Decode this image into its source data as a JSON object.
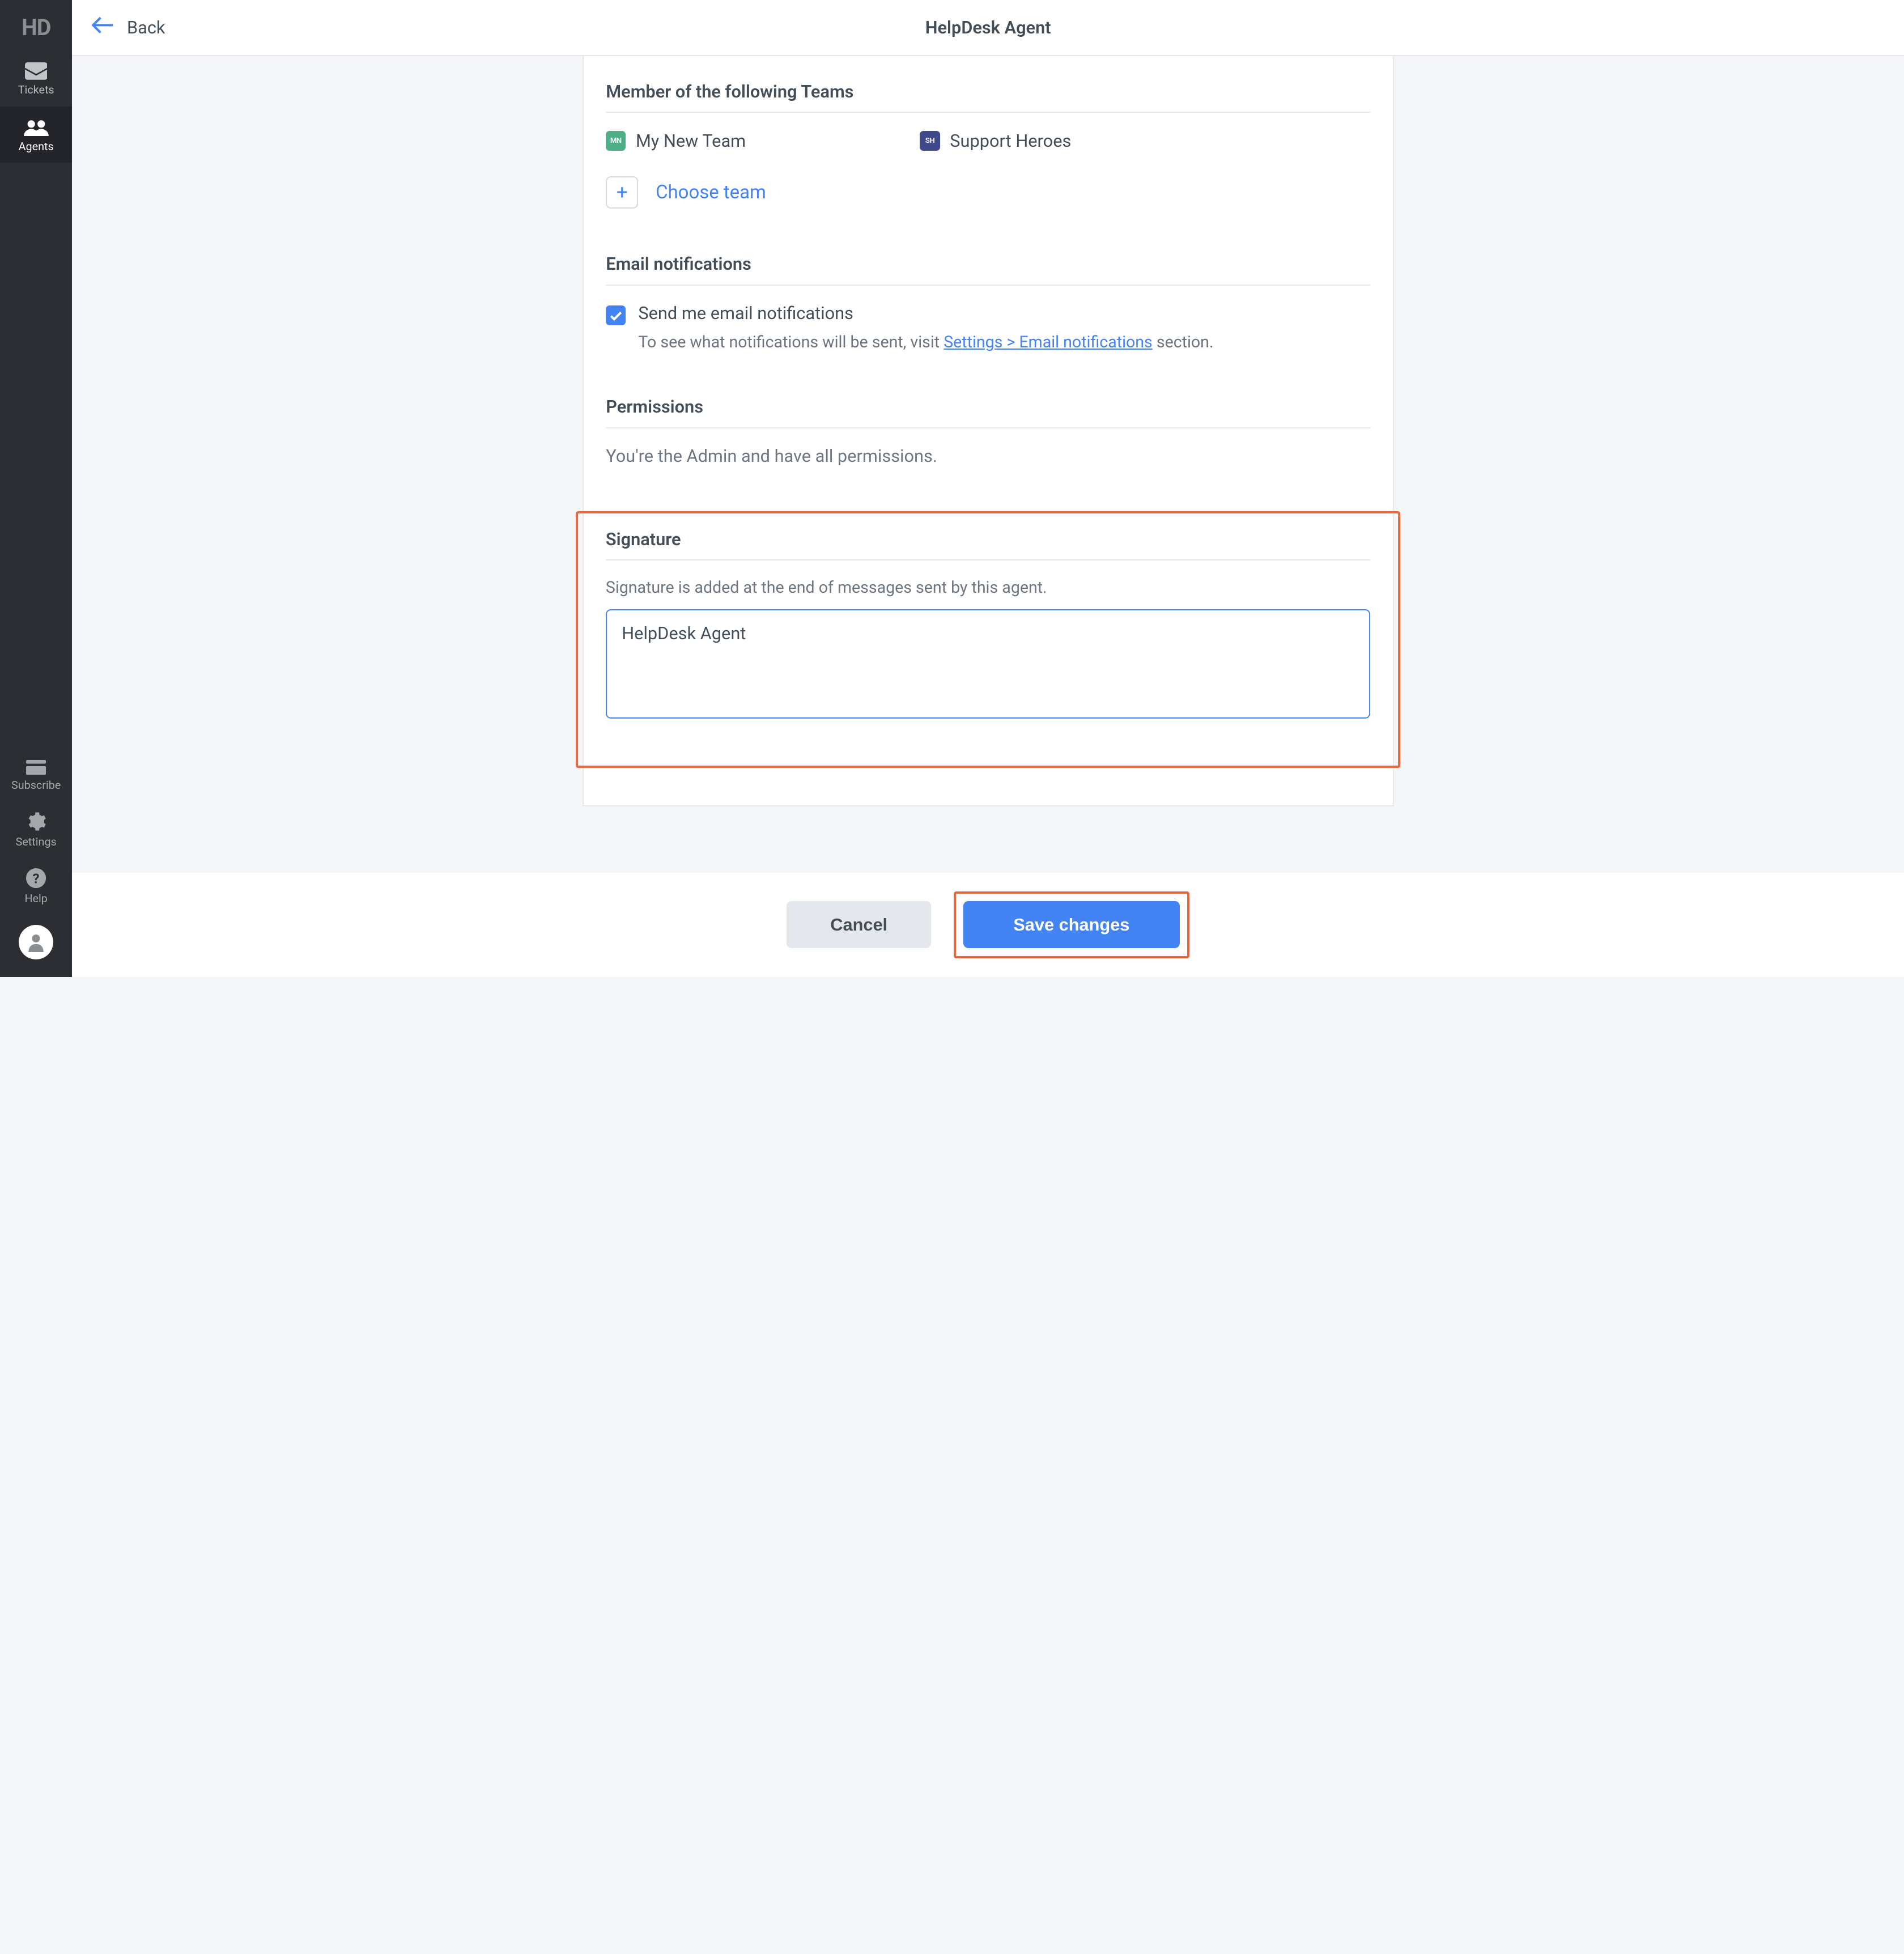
{
  "sidebar": {
    "logo": "HD",
    "items": [
      {
        "label": "Tickets"
      },
      {
        "label": "Agents"
      }
    ],
    "bottom": [
      {
        "label": "Subscribe"
      },
      {
        "label": "Settings"
      },
      {
        "label": "Help"
      }
    ]
  },
  "header": {
    "back_label": "Back",
    "title": "HelpDesk Agent"
  },
  "teams_section": {
    "title": "Member of the following Teams",
    "items": [
      {
        "initials": "MN",
        "name": "My New Team"
      },
      {
        "initials": "SH",
        "name": "Support Heroes"
      }
    ],
    "choose_team_label": "Choose team"
  },
  "email_section": {
    "title": "Email notifications",
    "checkbox_label": "Send me email notifications",
    "help_prefix": "To see what notifications will be sent, visit ",
    "help_link": "Settings > Email notifications",
    "help_suffix": " section."
  },
  "permissions_section": {
    "title": "Permissions",
    "text": "You're the Admin and have all permissions."
  },
  "signature_section": {
    "title": "Signature",
    "help": "Signature is added at the end of messages sent by this agent.",
    "value": "HelpDesk Agent"
  },
  "footer": {
    "cancel_label": "Cancel",
    "save_label": "Save changes"
  }
}
